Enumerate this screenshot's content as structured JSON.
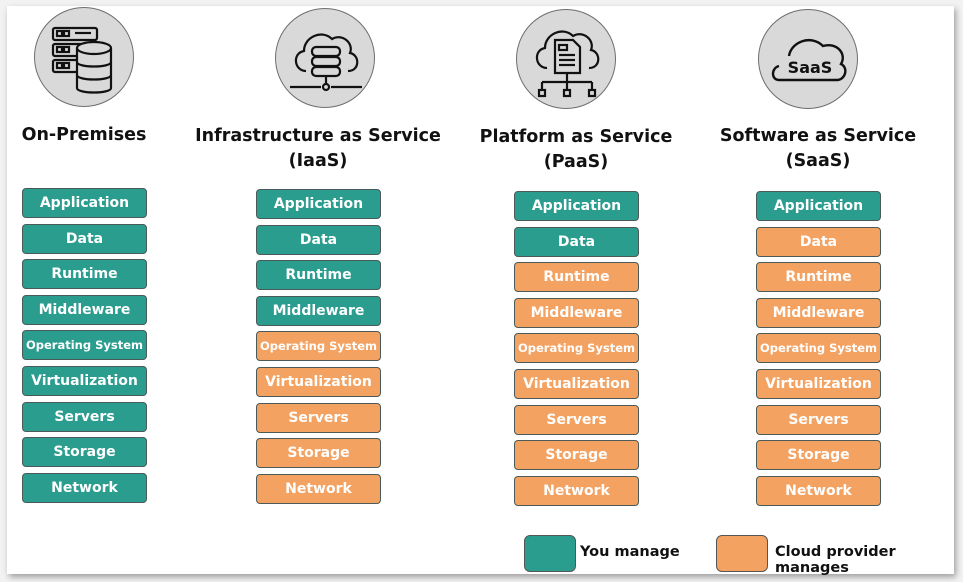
{
  "colors": {
    "you_manage": "#2a9d8f",
    "provider_manages": "#f4a261"
  },
  "columns": [
    {
      "title_line1": "On-Premises",
      "title_line2": "",
      "icon": "server-database-icon",
      "layers": [
        {
          "label": "Application",
          "managed_by": "you"
        },
        {
          "label": "Data",
          "managed_by": "you"
        },
        {
          "label": "Runtime",
          "managed_by": "you"
        },
        {
          "label": "Middleware",
          "managed_by": "you"
        },
        {
          "label": "Operating System",
          "managed_by": "you"
        },
        {
          "label": "Virtualization",
          "managed_by": "you"
        },
        {
          "label": "Servers",
          "managed_by": "you"
        },
        {
          "label": "Storage",
          "managed_by": "you"
        },
        {
          "label": "Network",
          "managed_by": "you"
        }
      ]
    },
    {
      "title_line1": "Infrastructure as Service",
      "title_line2": "(IaaS)",
      "icon": "cloud-server-icon",
      "layers": [
        {
          "label": "Application",
          "managed_by": "you"
        },
        {
          "label": "Data",
          "managed_by": "you"
        },
        {
          "label": "Runtime",
          "managed_by": "you"
        },
        {
          "label": "Middleware",
          "managed_by": "you"
        },
        {
          "label": "Operating System",
          "managed_by": "provider"
        },
        {
          "label": "Virtualization",
          "managed_by": "provider"
        },
        {
          "label": "Servers",
          "managed_by": "provider"
        },
        {
          "label": "Storage",
          "managed_by": "provider"
        },
        {
          "label": "Network",
          "managed_by": "provider"
        }
      ]
    },
    {
      "title_line1": "Platform as Service",
      "title_line2": "(PaaS)",
      "icon": "cloud-document-network-icon",
      "layers": [
        {
          "label": "Application",
          "managed_by": "you"
        },
        {
          "label": "Data",
          "managed_by": "you"
        },
        {
          "label": "Runtime",
          "managed_by": "provider"
        },
        {
          "label": "Middleware",
          "managed_by": "provider"
        },
        {
          "label": "Operating System",
          "managed_by": "provider"
        },
        {
          "label": "Virtualization",
          "managed_by": "provider"
        },
        {
          "label": "Servers",
          "managed_by": "provider"
        },
        {
          "label": "Storage",
          "managed_by": "provider"
        },
        {
          "label": "Network",
          "managed_by": "provider"
        }
      ]
    },
    {
      "title_line1": "Software as Service",
      "title_line2": "(SaaS)",
      "icon": "saas-cloud-icon",
      "icon_text": "SaaS",
      "layers": [
        {
          "label": "Application",
          "managed_by": "you"
        },
        {
          "label": "Data",
          "managed_by": "provider"
        },
        {
          "label": "Runtime",
          "managed_by": "provider"
        },
        {
          "label": "Middleware",
          "managed_by": "provider"
        },
        {
          "label": "Operating System",
          "managed_by": "provider"
        },
        {
          "label": "Virtualization",
          "managed_by": "provider"
        },
        {
          "label": "Servers",
          "managed_by": "provider"
        },
        {
          "label": "Storage",
          "managed_by": "provider"
        },
        {
          "label": "Network",
          "managed_by": "provider"
        }
      ]
    }
  ],
  "legend": {
    "you_manage": "You manage",
    "provider_manages": "Cloud provider manages"
  }
}
